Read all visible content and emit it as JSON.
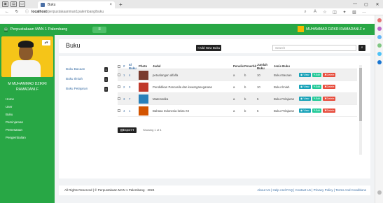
{
  "browser": {
    "tab_title": "Buku",
    "url_host": "localhost",
    "url_path": "/perpustakaanman1palembang/buku"
  },
  "app": {
    "brand": "Perpustakaan MAN 1 Palembang",
    "toggle_glyph": "≡",
    "user_name": "MUHAMMAD DZIKRI RAMADANI.F"
  },
  "sidebar": {
    "user_display": "M MUHAMMAD DZIKRI RAMADANI.F",
    "menu": [
      "Home",
      "User",
      "Buku",
      "Peminjaman",
      "Pemesanan",
      "Pengembalian"
    ]
  },
  "page": {
    "title": "Buku",
    "add_button": "+Add New Buku",
    "search_placeholder": "Search",
    "export_button": "Export",
    "shown_text": "Showing 1 of 4"
  },
  "filters": [
    {
      "label": "Buku Bacaan",
      "count": "1"
    },
    {
      "label": "Buku Ilmiah",
      "count": "1"
    },
    {
      "label": "Buku Pelajaran",
      "count": "2"
    }
  ],
  "table": {
    "headers": [
      "#",
      "Id Buku",
      "Photo",
      "Judul",
      "Penulis",
      "Penerbit",
      "Jumlah Buku",
      "Jenis Buku"
    ],
    "rows": [
      {
        "no": "1",
        "id": "4",
        "judul": "petualangan alfalfa",
        "penulis": "a",
        "penerbit": "b",
        "jumlah": "10",
        "jenis": "Buku Bacaan",
        "thumb": "#7a3b2e"
      },
      {
        "no": "2",
        "id": "3",
        "judul": "Pendidikan Pancasila dan kewarganegaraan",
        "penulis": "a",
        "penerbit": "b",
        "jumlah": "10",
        "jenis": "Buku Ilmiah",
        "thumb": "#c0392b"
      },
      {
        "no": "3",
        "id": "7",
        "judul": "Matematika",
        "penulis": "a",
        "penerbit": "b",
        "jumlah": "5",
        "jenis": "Buku Pelajaran",
        "thumb": "#2980b9"
      },
      {
        "no": "4",
        "id": "1",
        "judul": "Bahasa Indonesia kelas XII",
        "penulis": "a",
        "penerbit": "b",
        "jumlah": "5",
        "jenis": "Buku Pelajaran",
        "thumb": "#d35400"
      }
    ],
    "actions": {
      "view": "View",
      "edit": "Edit",
      "del": "Delete"
    }
  },
  "footer": {
    "left": "All Rights Reserved | © Perpustakaan MAN 1 Palembang · 2024",
    "right": "About Us | Help And FAQ | Contact Us | Privacy Policy | Terms And Conditions"
  },
  "colors": {
    "header": "#28a745",
    "sidebar": "#28a745"
  }
}
